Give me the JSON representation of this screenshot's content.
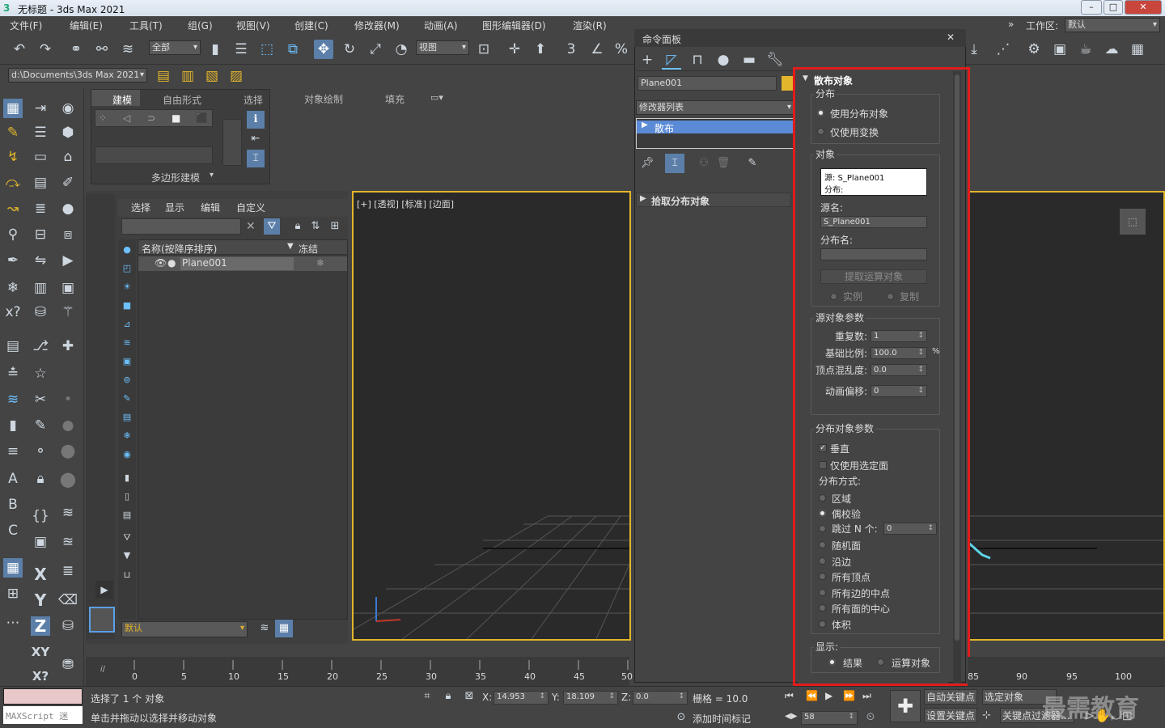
{
  "window": {
    "title": "无标题 - 3ds Max 2021",
    "min": "–",
    "max": "□",
    "close": "✕"
  },
  "menu": [
    "文件(F)",
    "编辑(E)",
    "工具(T)",
    "组(G)",
    "视图(V)",
    "创建(C)",
    "修改器(M)",
    "动画(A)",
    "图形编辑器(D)",
    "渲染(R)"
  ],
  "menu_right": {
    "workspace_label": "工作区:",
    "workspace_value": "默认"
  },
  "toolbar": {
    "filter_value": "全部",
    "view_value": "视图",
    "path_value": "d:\\Documents\\3ds Max 2021"
  },
  "ribbon": {
    "tabs": [
      "建模",
      "自由形式",
      "选择",
      "对象绘制",
      "填充"
    ],
    "active_tab": "建模",
    "sub_label": "多边形建模"
  },
  "scene_explorer": {
    "menu": [
      "选择",
      "显示",
      "编辑",
      "自定义"
    ],
    "col_name": "名称(按降序排序)",
    "col_freeze": "冻结",
    "rows": [
      {
        "name": "Plane001"
      }
    ],
    "layer_value": "默认"
  },
  "viewport": {
    "label": "[+] [透视] [标准] [边面]"
  },
  "command_panel": {
    "title": "命令面板",
    "object_name": "Plane001",
    "modifier_list": "修改器列表",
    "stack_item": "散布",
    "pick_rollout": "拾取分布对象",
    "scatter": {
      "rollout_title": "散布对象",
      "distribution_group": "分布",
      "use_dist_object": "使用分布对象",
      "use_transforms": "仅使用变换",
      "objects_group": "对象",
      "source_line": "源: S_Plane001",
      "dist_line": "分布:",
      "source_name_label": "源名:",
      "source_name_value": "S_Plane001",
      "dist_name_label": "分布名:",
      "dist_name_value": "",
      "extract_button": "提取运算对象",
      "instance": "实例",
      "copy": "复制",
      "source_params_group": "源对象参数",
      "duplicates_label": "重复数:",
      "duplicates_value": "1",
      "base_scale_label": "基础比例:",
      "base_scale_value": "100.0",
      "base_scale_unit": "%",
      "vertex_chaos_label": "顶点混乱度:",
      "vertex_chaos_value": "0.0",
      "anim_offset_label": "动画偏移:",
      "anim_offset_value": "0",
      "dist_params_group": "分布对象参数",
      "perpendicular": "垂直",
      "selected_faces": "仅使用选定面",
      "method_label": "分布方式:",
      "methods": [
        "区域",
        "偶校验",
        "跳过 N 个:",
        "随机面",
        "沿边",
        "所有顶点",
        "所有边的中点",
        "所有面的中心",
        "体积"
      ],
      "selected_method": "偶校验",
      "skip_n_value": "0",
      "display_group": "显示:",
      "result": "结果",
      "operands": "运算对象"
    }
  },
  "timeline": {
    "ticks_left": [
      "0",
      "5",
      "10",
      "15",
      "20",
      "25",
      "30",
      "35",
      "40",
      "45",
      "50"
    ],
    "ticks_right": [
      "85",
      "90",
      "95",
      "100"
    ]
  },
  "status": {
    "maxscript": "MAXScript 迷",
    "selected": "选择了 1 个 对象",
    "hint": "单击并拖动以选择并移动对象",
    "x_label": "X:",
    "x_value": "14.953",
    "y_label": "Y:",
    "y_value": "18.109",
    "z_label": "Z:",
    "z_value": "0.0",
    "grid": "栅格 = 10.0",
    "add_time_tag": "添加时间标记",
    "frame_value": "58",
    "auto_key": "自动关键点",
    "selected_obj": "选定对象",
    "set_key": "设置关键点",
    "key_filters": "关键点过滤器...",
    "watermark": "最需教育"
  },
  "colors": {
    "highlight_red": "#e31b1b",
    "viewport_border": "#e2b52b",
    "stack_blue": "#5b8bd6"
  }
}
